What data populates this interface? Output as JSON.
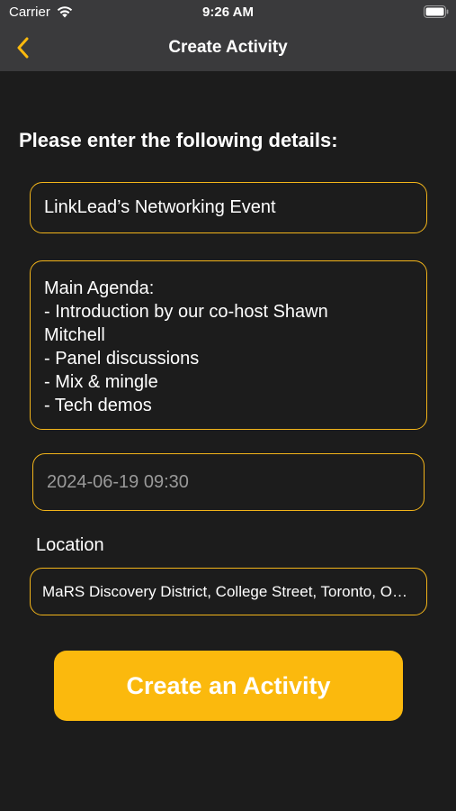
{
  "status_bar": {
    "carrier": "Carrier",
    "time": "9:26 AM"
  },
  "nav": {
    "title": "Create Activity",
    "back_icon": "chevron-left-icon"
  },
  "form": {
    "heading": "Please enter the following details:",
    "title_value": "LinkLead’s Networking Event",
    "agenda_lines": [
      "Main Agenda:",
      "- Introduction by our co-host Shawn",
      "Mitchell",
      "- Panel discussions",
      "- Mix & mingle",
      "- Tech demos"
    ],
    "date_value": "2024-06-19 09:30",
    "location_label": "Location",
    "location_value": "MaRS Discovery District, College Street, Toronto, ON, Canada"
  },
  "actions": {
    "create_label": "Create an Activity"
  },
  "colors": {
    "accent": "#fbb90d",
    "border": "#f2b41a",
    "background": "#1c1c1c",
    "topbar": "#3a3a3c"
  }
}
